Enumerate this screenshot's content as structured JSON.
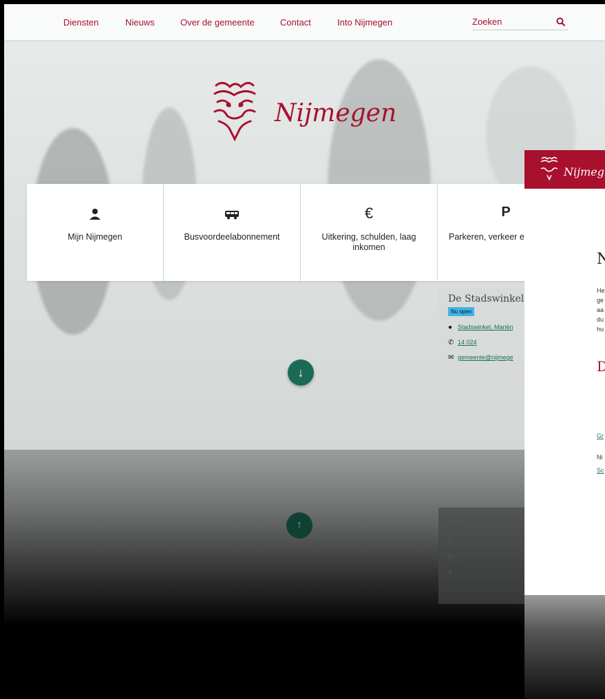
{
  "nav": {
    "items": [
      "Diensten",
      "Nieuws",
      "Over de gemeente",
      "Contact",
      "Into Nijmegen"
    ],
    "search_placeholder": "Zoeken"
  },
  "logo": {
    "text": "Nijmegen"
  },
  "cards": [
    {
      "icon": "person-icon",
      "label": "Mijn Nijmegen"
    },
    {
      "icon": "bus-icon",
      "label": "Busvoordeelabonnement"
    },
    {
      "icon": "euro-icon",
      "label": "Uitkering, schulden, laag inkomen"
    },
    {
      "icon": "parking-icon",
      "label": "Parkeren, verkeer e"
    }
  ],
  "info": {
    "title": "De Stadswinkel",
    "badge": "Nu open",
    "address": "Stadswinkel, Mariën",
    "phone": "14 024",
    "email": "gemeente@nijmege"
  },
  "panel": {
    "logo_text": "Nijmeg",
    "heading": "N",
    "para": [
      "He",
      "ge",
      "aa",
      "du",
      "hu"
    ],
    "subheading": "D",
    "link1": "Gr",
    "text1": "Ni",
    "link2": "Sc"
  },
  "colors": {
    "brand": "#a8102e",
    "accent": "#1b6a55",
    "badge": "#3fb3e8"
  }
}
